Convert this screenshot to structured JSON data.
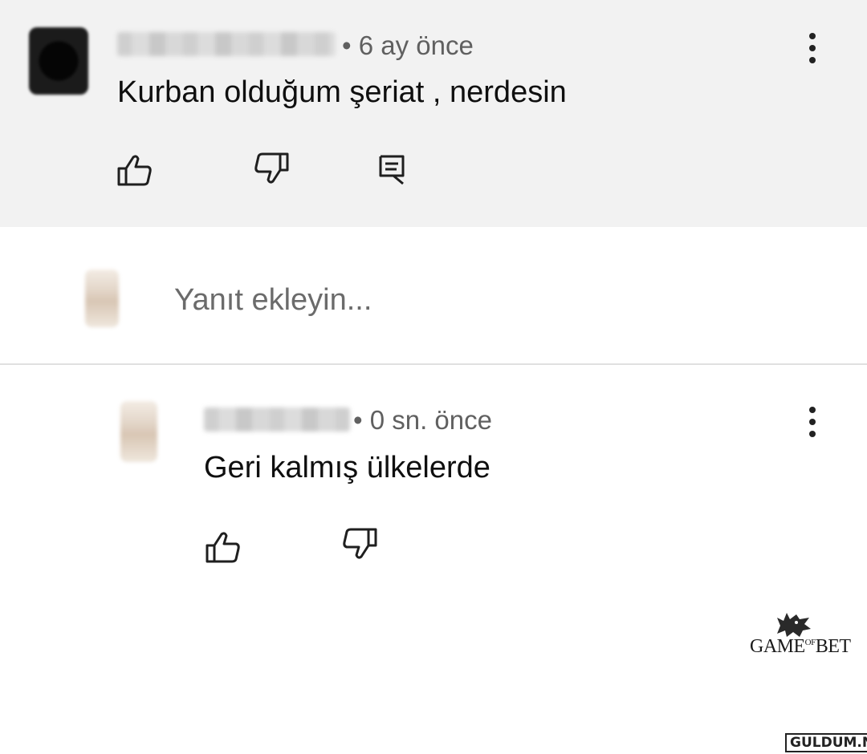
{
  "comment": {
    "meta": "• 6 ay önce",
    "text": "Kurban olduğum şeriat , nerdesin"
  },
  "reply_input": {
    "placeholder": "Yanıt ekleyin..."
  },
  "reply": {
    "meta": "• 0 sn. önce",
    "text": "Geri kalmış ülkelerde"
  },
  "watermark": {
    "brand_pre": "GAME",
    "brand_mid": "OF",
    "brand_post": "BET",
    "site": "GULDUM.NET"
  },
  "icons": {
    "like": "thumbs-up-icon",
    "dislike": "thumbs-down-icon",
    "reply": "comment-reply-icon",
    "menu": "more-vertical-icon"
  }
}
